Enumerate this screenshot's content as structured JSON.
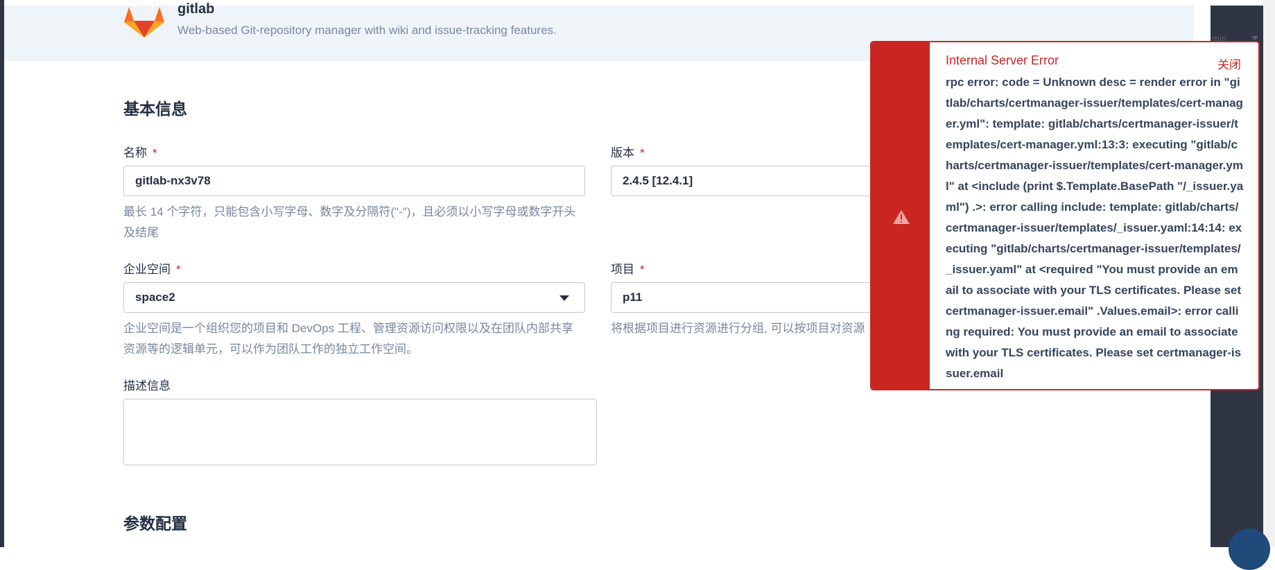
{
  "app": {
    "name": "gitlab",
    "description": "Web-based Git-repository manager with wiki and issue-tracking features."
  },
  "sections": {
    "basic_info": "基本信息",
    "params": "参数配置"
  },
  "form": {
    "name": {
      "label": "名称",
      "required_mark": "*",
      "value": "gitlab-nx3v78",
      "hint": "最长 14 个字符，只能包含小写字母、数字及分隔符(\"-\")，且必须以小写字母或数字开头及结尾"
    },
    "version": {
      "label": "版本",
      "required_mark": "*",
      "value": "2.4.5 [12.4.1]"
    },
    "workspace": {
      "label": "企业空间",
      "required_mark": "*",
      "value": "space2",
      "hint": "企业空间是一个组织您的项目和 DevOps 工程、管理资源访问权限以及在团队内部共享资源等的逻辑单元，可以作为团队工作的独立工作空间。"
    },
    "project": {
      "label": "项目",
      "required_mark": "*",
      "value": "p11",
      "hint": "将根据项目进行资源进行分组, 可以按项目对资源"
    },
    "description": {
      "label": "描述信息",
      "value": ""
    }
  },
  "error_notification": {
    "title": "Internal Server Error",
    "close_label": "关闭",
    "message": "rpc error: code = Unknown desc = render error in \"gitlab/charts/certmanager-issuer/templates/cert-manager.yml\": template: gitlab/charts/certmanager-issuer/templates/cert-manager.yml:13:3: executing \"gitlab/charts/certmanager-issuer/templates/cert-manager.yml\" at <include (print $.Template.BasePath \"/_issuer.yaml\") .>: error calling include: template: gitlab/charts/certmanager-issuer/templates/_issuer.yaml:14:14: executing \"gitlab/charts/certmanager-issuer/templates/_issuer.yaml\" at <required \"You must provide an email to associate with your TLS certificates. Please set certmanager-issuer.email\" .Values.email>: error calling required: You must provide an email to associate with your TLS certificates. Please set certmanager-issuer.email",
    "icon": "warning-icon"
  },
  "right_rail": {
    "user_label": "min"
  },
  "colors": {
    "error_red": "#ca2621",
    "header_bg": "#eff4f9",
    "text_primary": "#242e42",
    "text_muted": "#79879c"
  }
}
